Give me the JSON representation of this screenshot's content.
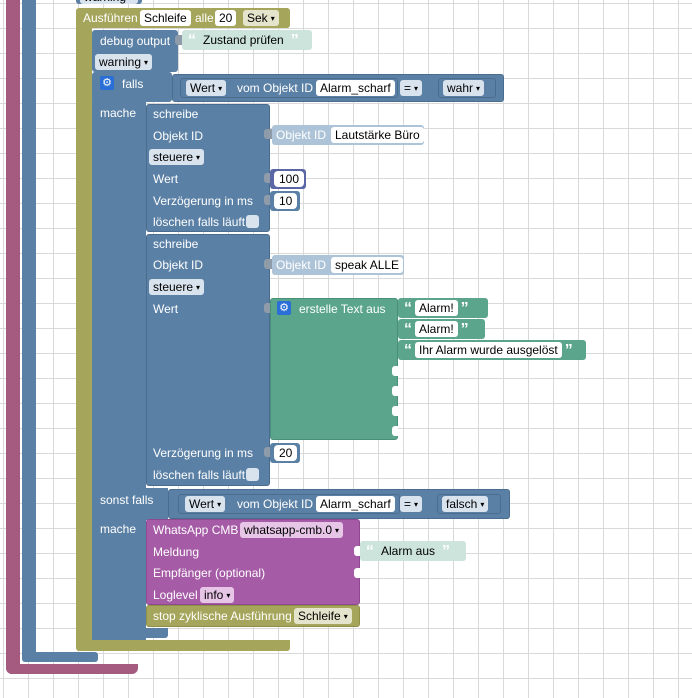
{
  "colors": {
    "outer_block": "#a55b80",
    "loop_block": "#a5a55b",
    "if_block": "#5b80a5",
    "text_block": "#5ba58c",
    "whatsapp_block": "#a55ba5"
  },
  "top_partial": {
    "label": "warning"
  },
  "interval": {
    "label": "Ausführen",
    "name": "Schleife",
    "every_label": "alle",
    "value": "20",
    "unit": "Sek"
  },
  "debug": {
    "label": "debug output",
    "message": "Zustand prüfen",
    "level": "warning"
  },
  "if_block": {
    "if_label": "falls",
    "do_label": "mache",
    "else_if_label": "sonst falls",
    "do2_label": "mache",
    "cond1": {
      "attr": "Wert",
      "of_label": "vom Objekt ID",
      "object": "Alarm_scharf",
      "op": "=",
      "value": "wahr"
    },
    "cond2": {
      "attr": "Wert",
      "of_label": "vom Objekt ID",
      "object": "Alarm_scharf",
      "op": "=",
      "value": "falsch"
    }
  },
  "write1": {
    "title": "schreibe",
    "object_label": "Objekt ID",
    "object_prefix": "Objekt ID",
    "object_value": "Lautstärke Büro",
    "mode": "steuere",
    "value_label": "Wert",
    "value": "100",
    "delay_label": "Verzögerung in ms",
    "delay": "10",
    "clear_label": "löschen falls läuft"
  },
  "write2": {
    "title": "schreibe",
    "object_label": "Objekt ID",
    "object_prefix": "Objekt ID",
    "object_value": "speak ALLE",
    "mode": "steuere",
    "value_label": "Wert",
    "delay_label": "Verzögerung in ms",
    "delay": "20",
    "clear_label": "löschen falls läuft"
  },
  "text_join": {
    "label": "erstelle Text aus",
    "items": [
      "Alarm!",
      "Alarm!",
      "Ihr Alarm wurde ausgelöst"
    ]
  },
  "whatsapp": {
    "label": "WhatsApp CMB",
    "instance": "whatsapp-cmb.0",
    "message_label": "Meldung",
    "message": "Alarm aus",
    "recipient_label": "Empfänger (optional)",
    "loglevel_label": "Loglevel",
    "loglevel": "info"
  },
  "stop": {
    "label": "stop zyklische Ausführung",
    "name": "Schleife"
  }
}
